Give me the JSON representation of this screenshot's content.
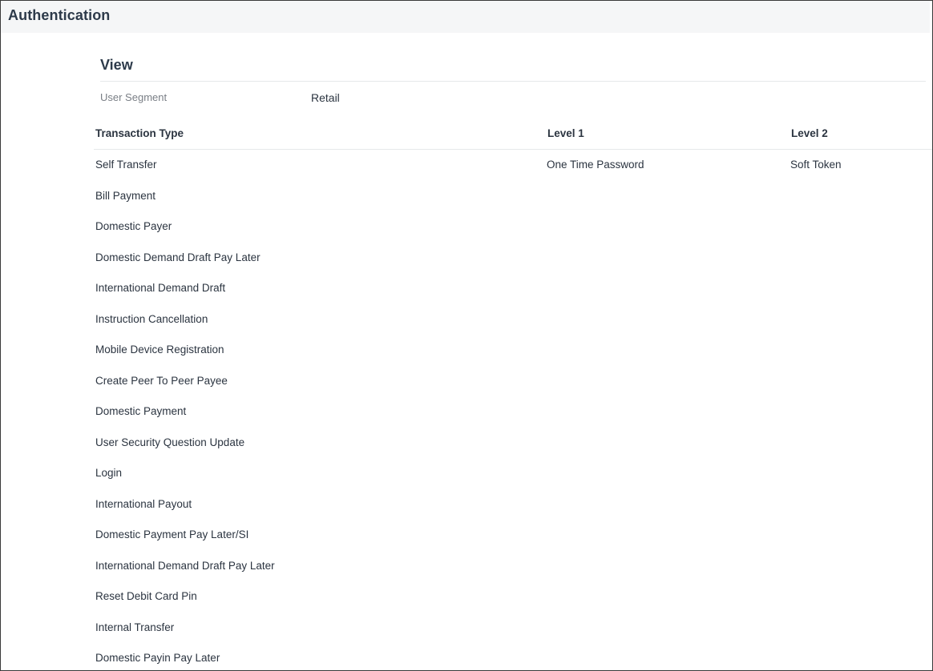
{
  "header": {
    "title": "Authentication"
  },
  "view": {
    "title": "View",
    "segment_label": "User Segment",
    "segment_value": "Retail"
  },
  "table": {
    "columns": [
      "Transaction Type",
      "Level 1",
      "Level 2"
    ],
    "rows": [
      {
        "type": "Self Transfer",
        "level1": "One Time Password",
        "level2": "Soft Token"
      },
      {
        "type": "Bill Payment",
        "level1": "",
        "level2": ""
      },
      {
        "type": "Domestic Payer",
        "level1": "",
        "level2": ""
      },
      {
        "type": "Domestic Demand Draft Pay Later",
        "level1": "",
        "level2": ""
      },
      {
        "type": "International Demand Draft",
        "level1": "",
        "level2": ""
      },
      {
        "type": "Instruction Cancellation",
        "level1": "",
        "level2": ""
      },
      {
        "type": "Mobile Device Registration",
        "level1": "",
        "level2": ""
      },
      {
        "type": "Create Peer To Peer Payee",
        "level1": "",
        "level2": ""
      },
      {
        "type": "Domestic Payment",
        "level1": "",
        "level2": ""
      },
      {
        "type": "User Security Question Update",
        "level1": "",
        "level2": ""
      },
      {
        "type": "Login",
        "level1": "",
        "level2": ""
      },
      {
        "type": "International Payout",
        "level1": "",
        "level2": ""
      },
      {
        "type": "Domestic Payment Pay Later/SI",
        "level1": "",
        "level2": ""
      },
      {
        "type": "International Demand Draft Pay Later",
        "level1": "",
        "level2": ""
      },
      {
        "type": "Reset Debit Card Pin",
        "level1": "",
        "level2": ""
      },
      {
        "type": "Internal Transfer",
        "level1": "",
        "level2": ""
      },
      {
        "type": "Domestic Payin Pay Later",
        "level1": "",
        "level2": ""
      }
    ]
  }
}
